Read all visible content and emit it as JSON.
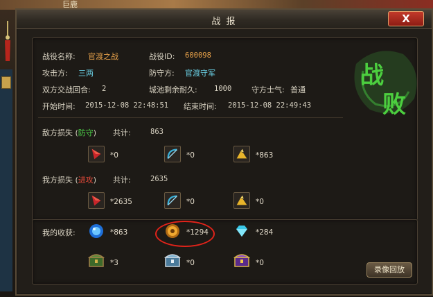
{
  "scene": {
    "top_label": "巨鹿"
  },
  "window": {
    "title": "战 报",
    "close": "X"
  },
  "battle": {
    "name_label": "战役名称:",
    "name_value": "官渡之战",
    "id_label": "战役ID:",
    "id_value": "600098",
    "attacker_label": "攻击方:",
    "attacker_value": "三两",
    "defender_label": "防守方:",
    "defender_value": "官渡守军",
    "rounds_label": "双方交战回合:",
    "rounds_value": "2",
    "durability_label": "城池剩余耐久:",
    "durability_value": "1000",
    "morale_label": "守方士气:",
    "morale_value": "普通",
    "start_label": "开始时间:",
    "start_value": "2015-12-08 22:48:51",
    "end_label": "结束时间:",
    "end_value": "2015-12-08 22:49:43"
  },
  "stamp": {
    "line1": "战",
    "line2": "败"
  },
  "enemy_loss": {
    "label_prefix": "敌方损失 (",
    "label_role": "防守",
    "label_suffix": ")",
    "total_label": "共计:",
    "total_value": "863",
    "units": [
      {
        "icon": "sword-icon",
        "count": "*0"
      },
      {
        "icon": "bow-icon",
        "count": "*0"
      },
      {
        "icon": "cavalry-icon",
        "count": "*863"
      }
    ]
  },
  "our_loss": {
    "label_prefix": "我方损失 (",
    "label_role": "进攻",
    "label_suffix": ")",
    "total_label": "共计:",
    "total_value": "2635",
    "units": [
      {
        "icon": "sword-icon",
        "count": "*2635"
      },
      {
        "icon": "bow-icon",
        "count": "*0"
      },
      {
        "icon": "cavalry-icon",
        "count": "*0"
      }
    ]
  },
  "rewards": {
    "label": "我的收获:",
    "items": [
      {
        "icon": "blue-orb-icon",
        "count": "*863"
      },
      {
        "icon": "gold-coin-icon",
        "count": "*1294"
      },
      {
        "icon": "diamond-icon",
        "count": "*284"
      },
      {
        "icon": "green-chest-icon",
        "count": "*3"
      },
      {
        "icon": "silver-chest-icon",
        "count": "*0"
      },
      {
        "icon": "purple-chest-icon",
        "count": "*0"
      }
    ]
  },
  "replay_button": "录像回放",
  "colors": {
    "orange": "#e8a24a",
    "cyan": "#6bd3e8",
    "green": "#4fd84a",
    "red": "#e64a3a",
    "stamp_green": "#3fae3a"
  }
}
